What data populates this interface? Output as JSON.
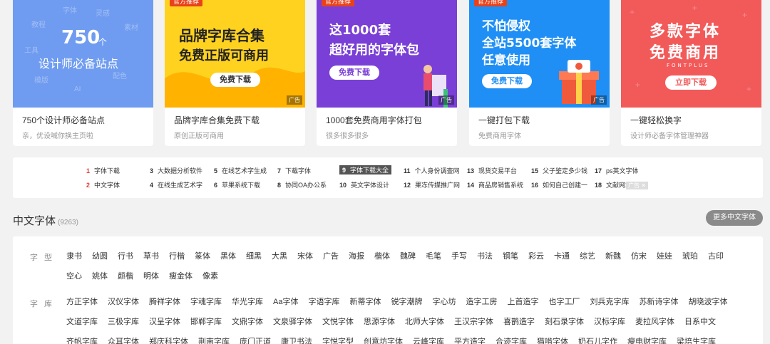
{
  "cards": [
    {
      "banner_words": [
        "字体",
        "灵感",
        "教程",
        "素材",
        "工具",
        "配色",
        "模版",
        "AI"
      ],
      "big_num": "750",
      "big_unit": "个",
      "big_line2": "设计师必备站点",
      "title": "750个设计师必备站点",
      "desc": "亲，优设喊你换主页啦"
    },
    {
      "tag": "官方推荐",
      "line1": "品牌字库合集",
      "line2": "免费正版可商用",
      "button": "免费下载",
      "ad": "广告",
      "title": "品牌字库合集免费下载",
      "desc": "原创正版可商用"
    },
    {
      "tag": "官方推荐",
      "line1": "这1000套",
      "line2": "超好用的字体包",
      "button": "免费下载",
      "ad": "广告",
      "title": "1000套免费商用字体打包",
      "desc": "很多很多很多"
    },
    {
      "tag": "官方推荐",
      "line1": "不怕侵权",
      "line2": "全站5500套字体",
      "line3": "任意使用",
      "button": "免费下载",
      "ad": "广告",
      "title": "一键打包下载",
      "desc": "免费商用字体"
    },
    {
      "line1": "多款字体",
      "line2": "免费商用",
      "sub": "FONTPLUS",
      "button": "立即下载",
      "title": "一键轻松换字",
      "desc": "设计师必备字体管理神器"
    }
  ],
  "hot_links": [
    {
      "n": "1",
      "t": "字体下载"
    },
    {
      "n": "2",
      "t": "中文字体"
    },
    {
      "n": "3",
      "t": "大数据分析软件"
    },
    {
      "n": "4",
      "t": "在线生成艺术字"
    },
    {
      "n": "5",
      "t": "在线艺术字生成"
    },
    {
      "n": "6",
      "t": "苹果系统下载"
    },
    {
      "n": "7",
      "t": "下载字体"
    },
    {
      "n": "8",
      "t": "协同OA办公系"
    },
    {
      "n": "9",
      "t": "字体下载大全"
    },
    {
      "n": "10",
      "t": "英文字体设计"
    },
    {
      "n": "11",
      "t": "个人身份调查网"
    },
    {
      "n": "12",
      "t": "果冻传媒推广网"
    },
    {
      "n": "13",
      "t": "现货交易平台"
    },
    {
      "n": "14",
      "t": "商品房销售系统"
    },
    {
      "n": "15",
      "t": "父子鉴定多少钱"
    },
    {
      "n": "16",
      "t": "如何自己创建一"
    },
    {
      "n": "17",
      "t": "ps英文字体"
    },
    {
      "n": "18",
      "t": "文献网站"
    }
  ],
  "ad_badge": "广告",
  "section": {
    "title": "中文字体",
    "count": "(9263)",
    "more_button": "更多中文字体",
    "style_label": "字型",
    "styles": [
      "隶书",
      "幼圆",
      "行书",
      "草书",
      "行楷",
      "篆体",
      "黑体",
      "细黑",
      "大黑",
      "宋体",
      "广告",
      "海报",
      "楷体",
      "魏碑",
      "毛笔",
      "手写",
      "书法",
      "钢笔",
      "彩云",
      "卡通",
      "综艺",
      "新魏",
      "仿宋",
      "娃娃",
      "琥珀",
      "古印",
      "空心",
      "姚体",
      "颜楷",
      "明体",
      "瘦金体",
      "像素"
    ],
    "foundry_label": "字库",
    "foundries": [
      "方正字体",
      "汉仪字体",
      "腾祥字体",
      "字魂字库",
      "华光字库",
      "Aa字体",
      "字语字库",
      "新蒂字体",
      "锐字潮牌",
      "字心坊",
      "造字工房",
      "上首造字",
      "也字工厂",
      "刘兵克字库",
      "苏新诗字体",
      "胡晓波字体",
      "文道字库",
      "三极字库",
      "汉呈字体",
      "邯郸字库",
      "文鼎字体",
      "文泉驿字体",
      "文悦字体",
      "思源字体",
      "北师大字体",
      "王汉宗字体",
      "喜鹊造字",
      "刻石录字体",
      "汉标字库",
      "麦拉风字体",
      "日系中文",
      "齐帆字库",
      "众耳字体",
      "郑庆科字体",
      "荆南字库",
      "庞门正道",
      "康卫书法",
      "字悦字型",
      "创意坊字体",
      "云峰字库",
      "平方造字",
      "合迹字库",
      "猫啃字体",
      "奶石儿字作",
      "瘦电财字库",
      "梁培生字库"
    ]
  }
}
